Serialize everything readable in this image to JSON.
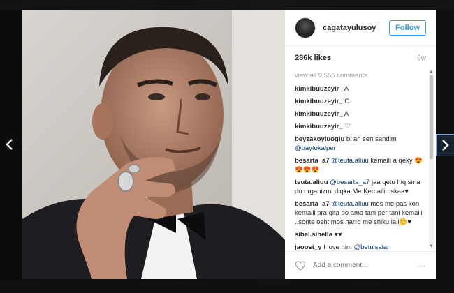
{
  "post": {
    "username": "cagatayulusoy",
    "follow_label": "Follow",
    "likes": "286k likes",
    "time": "6w",
    "view_all": "view all 9,556 comments",
    "add_comment_placeholder": "Add a comment...",
    "more": "∙∙∙"
  },
  "comments": [
    {
      "user": "kimkibuuzeyir_",
      "text": " A"
    },
    {
      "user": "kimkibuuzeyir_",
      "text": " C"
    },
    {
      "user": "kimkibuuzeyir_",
      "text": " A"
    },
    {
      "user": "kimkibuuzeyir_",
      "text": " ♡"
    },
    {
      "user": "beyzakoyluoglu",
      "text": " bi an sen sandim ",
      "mention": "@baytokalper"
    },
    {
      "user": "besarta_a7",
      "mention_first": " @teuta.aliuu",
      "text": " kemaili a qeky 😍😍😍😍"
    },
    {
      "user": "teuta.aliuu",
      "mention_first": " @besarta_a7",
      "text": " jaa qeto hiq sma do organizmi diqka Me Kemailin skaa♥"
    },
    {
      "user": "besarta_a7",
      "mention_first": " @teuta.aliuu",
      "text": " mos me pas kon kemaili pra qita po ama tani per tani kemaili ..sonte osht mos harro me shiku lali😊♥"
    },
    {
      "user": "sibel.sibella",
      "text": " ♥♥"
    },
    {
      "user": "jaoost_y",
      "text": " I love him ",
      "mention": "@betulsalar"
    }
  ],
  "icons": {
    "nav_left": "chevron-left-icon",
    "nav_right": "chevron-right-icon",
    "heart": "heart-icon",
    "avatar": "avatar"
  },
  "colors": {
    "accent": "#3897f0",
    "mention": "#003569"
  }
}
